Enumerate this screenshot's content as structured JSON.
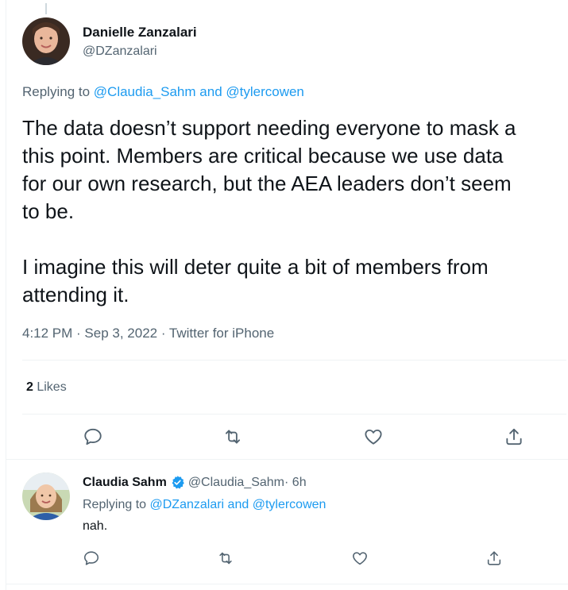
{
  "tweet": {
    "author_name": "Danielle Zanzalari",
    "author_handle": "@DZanzalari",
    "replying_prefix": "Replying to ",
    "replying_mention1": "@Claudia_Sahm",
    "replying_and": " and ",
    "replying_mention2": "@tylercowen",
    "body_lines": [
      "The data doesn’t support needing everyone to mask a",
      "this point. Members are critical because we use data",
      "for our own research, but the AEA leaders don’t seem",
      "to be."
    ],
    "body_para2_lines": [
      "I imagine this will deter quite a bit of members from",
      "attending it."
    ],
    "timestamp": "4:12 PM · Sep 3, 2022 · Twitter for iPhone",
    "likes_count": "2",
    "likes_label": " Likes"
  },
  "reply": {
    "author_name": "Claudia Sahm",
    "author_handle": "@Claudia_Sahm",
    "time": " · 6h",
    "replying_prefix": "Replying to ",
    "replying_mention1": "@DZanzalari",
    "replying_and": " and ",
    "replying_mention2": "@tylercowen",
    "body": "nah."
  },
  "icons": {
    "actions": [
      "reply-icon",
      "retweet-icon",
      "like-icon",
      "share-icon"
    ],
    "verified": "verified-badge-icon"
  },
  "colors": {
    "accent": "#1d9bf0",
    "secondary_text": "#536471",
    "primary_text": "#0f1419",
    "divider": "#eff3f4"
  }
}
